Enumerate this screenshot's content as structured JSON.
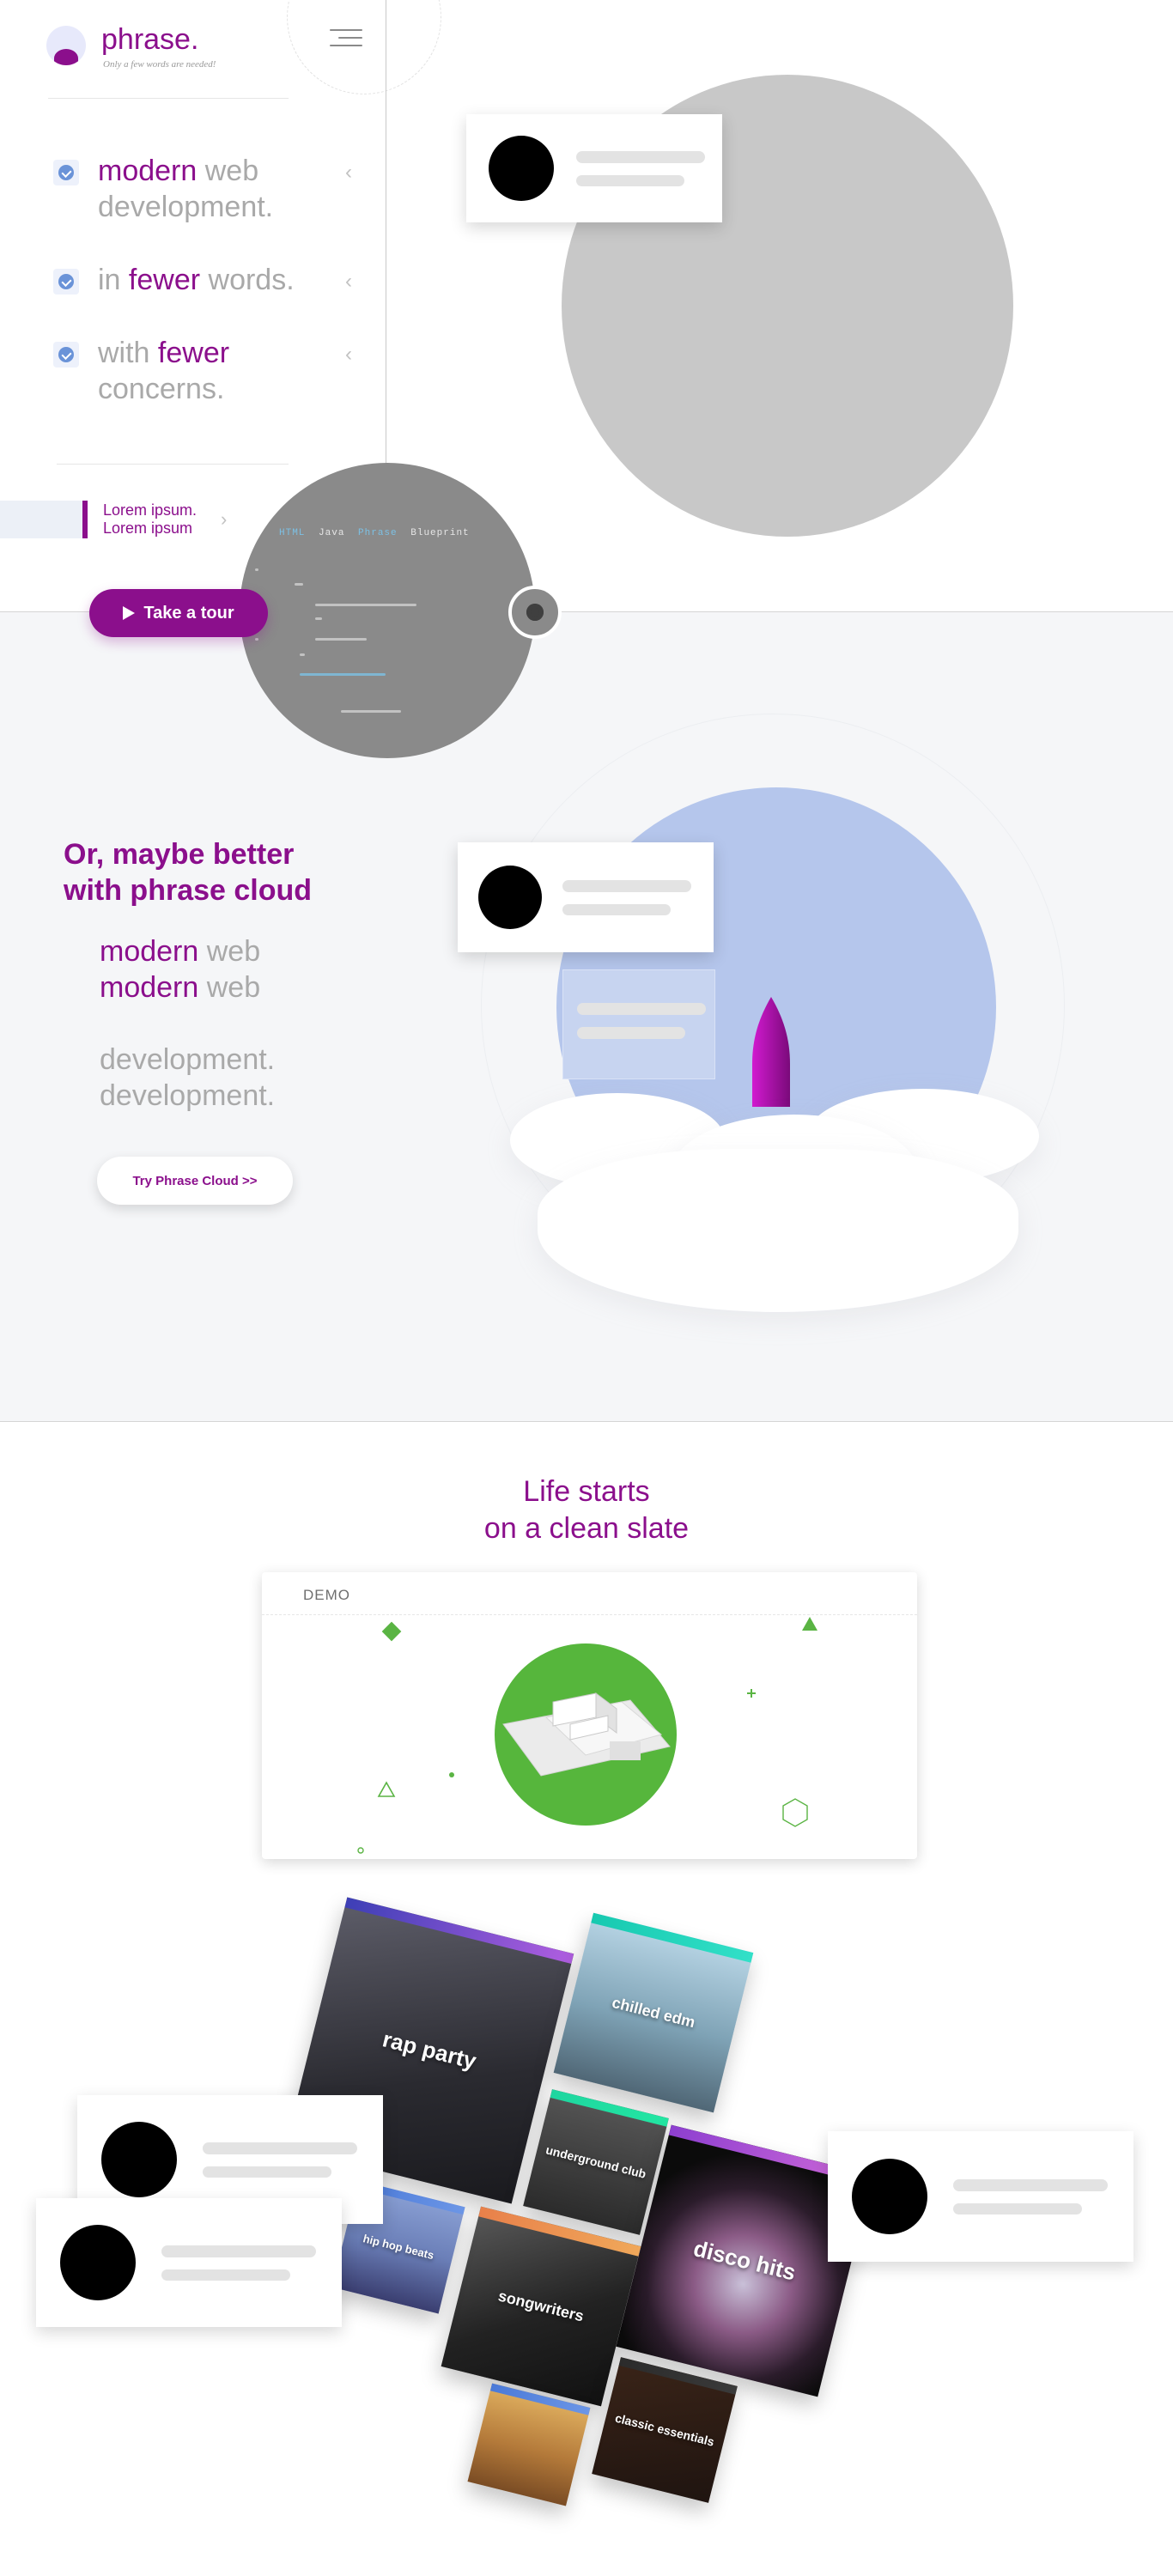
{
  "header": {
    "logo_text": "phrase.",
    "tagline": "Only a few words are needed!",
    "menu_icon": "hamburger-icon"
  },
  "features": [
    {
      "parts": [
        {
          "text": "modern",
          "accent": true
        },
        {
          "text": " web development.",
          "accent": false
        }
      ]
    },
    {
      "parts": [
        {
          "text": "in ",
          "accent": false
        },
        {
          "text": "fewer",
          "accent": true
        },
        {
          "text": " words.",
          "accent": false
        }
      ]
    },
    {
      "parts": [
        {
          "text": "with ",
          "accent": false
        },
        {
          "text": "fewer",
          "accent": true
        },
        {
          "text": " concerns.",
          "accent": false
        }
      ]
    }
  ],
  "lorem": {
    "line1": "Lorem ipsum.",
    "line2": "Lorem ipsum"
  },
  "tour_button": {
    "label": "Take a tour",
    "icon": "play-icon"
  },
  "code_preview": {
    "tabs": [
      "HTML",
      "Java",
      "Phrase",
      "Blueprint"
    ]
  },
  "github_icon": "github-icon",
  "cloud": {
    "heading_line1": "Or, maybe better",
    "heading_line2": "with phrase cloud",
    "lines": [
      {
        "parts": [
          {
            "text": "modern",
            "accent": true
          },
          {
            "text": " web",
            "accent": false
          }
        ]
      },
      {
        "parts": [
          {
            "text": "modern",
            "accent": true
          },
          {
            "text": " web",
            "accent": false
          }
        ]
      },
      {
        "parts": [
          {
            "text": "development.",
            "accent": false
          }
        ]
      },
      {
        "parts": [
          {
            "text": "development.",
            "accent": false
          }
        ]
      }
    ],
    "button_label": "Try Phrase Cloud >>"
  },
  "slate": {
    "title_line1": "Life starts",
    "title_line2": "on a clean slate",
    "demo_label": "DEMO"
  },
  "playlists": [
    {
      "label": "rap party"
    },
    {
      "label": "chilled edm"
    },
    {
      "label": "underground club"
    },
    {
      "label": "disco hits"
    },
    {
      "label": "songwriters"
    },
    {
      "label": "hip hop beats"
    },
    {
      "label": "classic essentials"
    },
    {
      "label": ""
    }
  ],
  "colors": {
    "brand": "#8b0f8c",
    "muted_text": "#a9a9a9",
    "placeholder_gray": "#c8c8c8",
    "cloud_blue": "#b5c6ec",
    "demo_green": "#56b63c",
    "section_bg": "#f5f6f8"
  }
}
